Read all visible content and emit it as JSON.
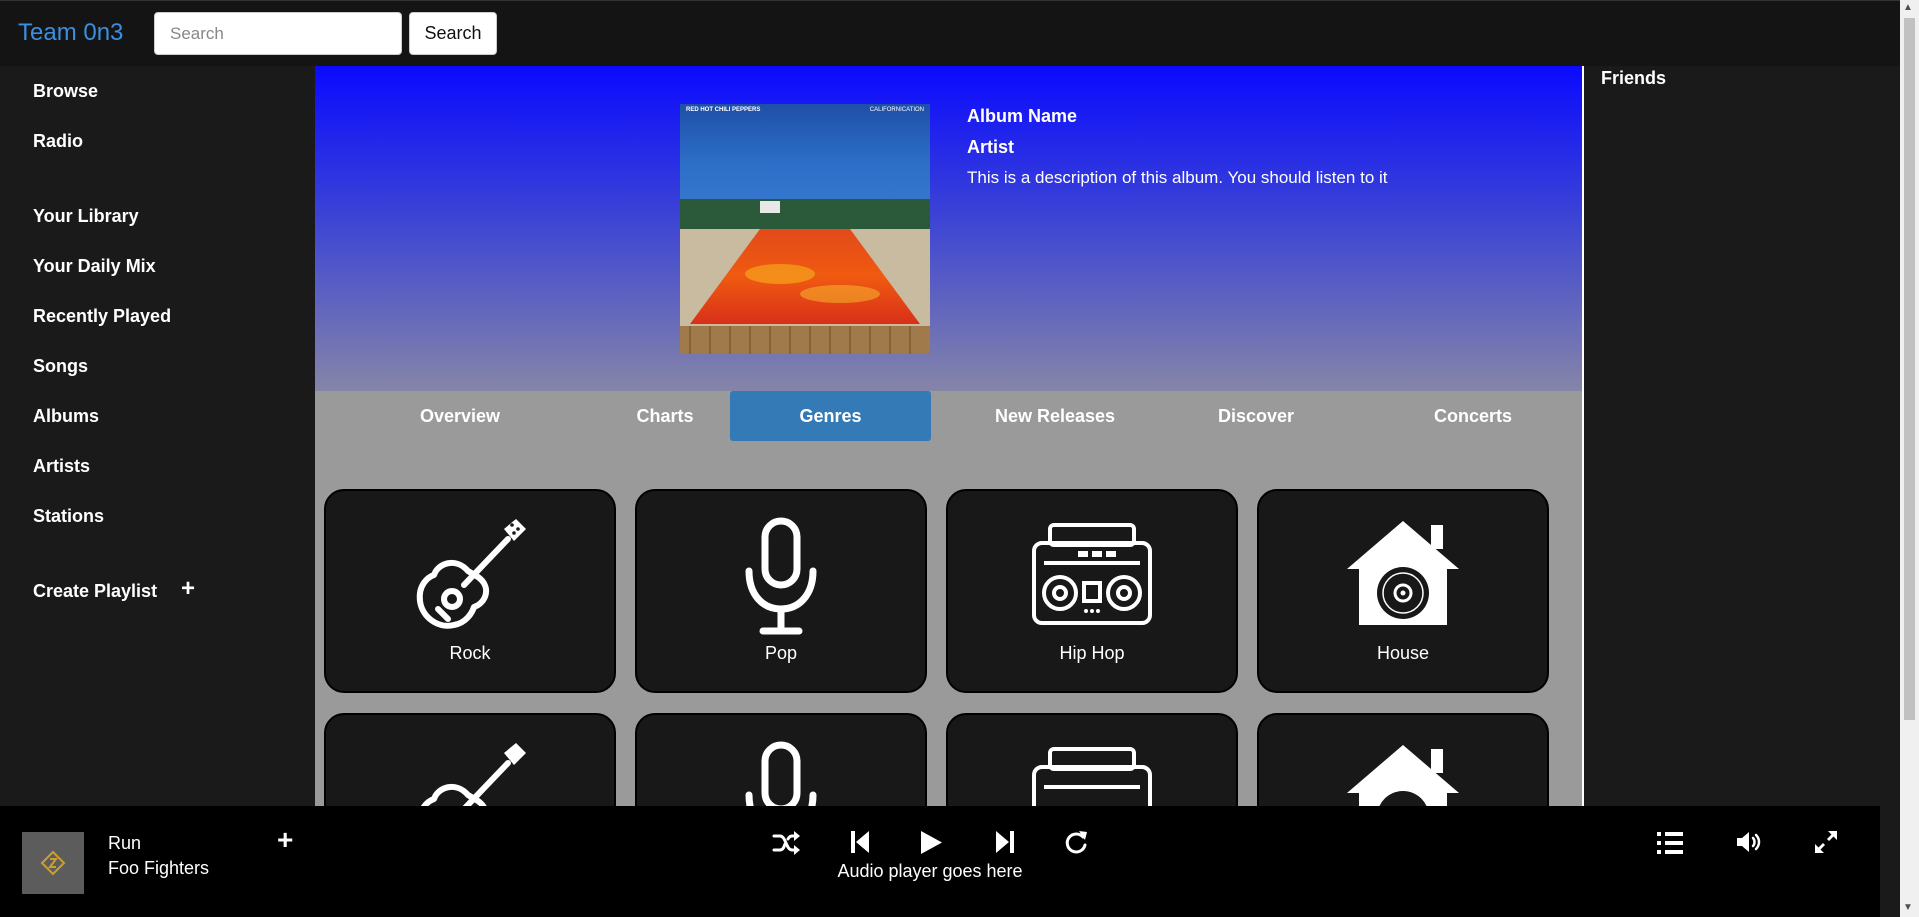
{
  "header": {
    "brand": "Team 0n3",
    "search_placeholder": "Search",
    "search_button": "Search"
  },
  "sidebar": {
    "items": [
      {
        "label": "Browse"
      },
      {
        "label": "Radio"
      },
      {
        "label": "Your Library"
      },
      {
        "label": "Your Daily Mix"
      },
      {
        "label": "Recently Played"
      },
      {
        "label": "Songs"
      },
      {
        "label": "Albums"
      },
      {
        "label": "Artists"
      },
      {
        "label": "Stations"
      }
    ],
    "create_playlist": "Create Playlist"
  },
  "album": {
    "name": "Album Name",
    "artist": "Artist",
    "description": "This is a description of this album. You should listen to it",
    "art_band": "RED HOT CHILI PEPPERS",
    "art_title": "CALIFORNICATION"
  },
  "tabs": [
    {
      "label": "Overview",
      "active": false
    },
    {
      "label": "Charts",
      "active": false
    },
    {
      "label": "Genres",
      "active": true
    },
    {
      "label": "New Releases",
      "active": false
    },
    {
      "label": "Discover",
      "active": false
    },
    {
      "label": "Concerts",
      "active": false
    }
  ],
  "genres": [
    {
      "label": "Rock",
      "icon": "guitar-icon"
    },
    {
      "label": "Pop",
      "icon": "microphone-icon"
    },
    {
      "label": "Hip Hop",
      "icon": "boombox-icon"
    },
    {
      "label": "House",
      "icon": "house-record-icon"
    }
  ],
  "friends": {
    "title": "Friends"
  },
  "player": {
    "track_title": "Run",
    "track_artist": "Foo Fighters",
    "audio_text": "Audio player goes here"
  },
  "colors": {
    "brand": "#3b8fe0",
    "active_tab": "#337ab7",
    "hero_top": "#0a0aff",
    "hero_bottom": "#8585a8"
  }
}
